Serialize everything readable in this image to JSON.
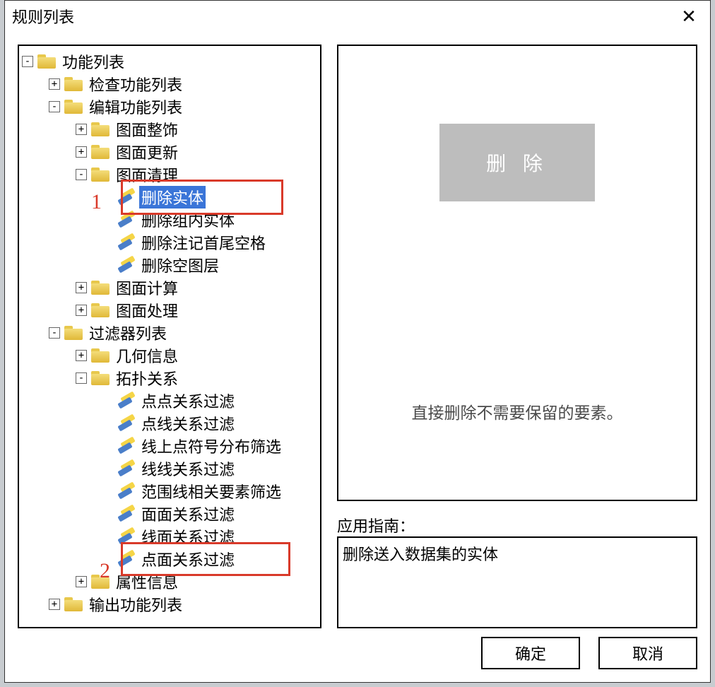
{
  "window": {
    "title": "规则列表"
  },
  "tree": {
    "root": {
      "label": "功能列表",
      "children": {
        "check": {
          "label": "检查功能列表"
        },
        "edit": {
          "label": "编辑功能列表",
          "children": {
            "decorate": {
              "label": "图面整饰"
            },
            "refresh": {
              "label": "图面更新"
            },
            "clean": {
              "label": "图面清理",
              "children": {
                "del_entity": {
                  "label": "删除实体"
                },
                "del_group": {
                  "label": "删除组内实体"
                },
                "del_anno": {
                  "label": "删除注记首尾空格"
                },
                "del_layer": {
                  "label": "删除空图层"
                }
              }
            },
            "calc": {
              "label": "图面计算"
            },
            "process": {
              "label": "图面处理"
            }
          }
        },
        "filter": {
          "label": "过滤器列表",
          "children": {
            "geom": {
              "label": "几何信息"
            },
            "topo": {
              "label": "拓扑关系",
              "children": {
                "pp": {
                  "label": "点点关系过滤"
                },
                "pl": {
                  "label": "点线关系过滤"
                },
                "lsym": {
                  "label": "线上点符号分布筛选"
                },
                "ll": {
                  "label": "线线关系过滤"
                },
                "range": {
                  "label": "范围线相关要素筛选"
                },
                "aa": {
                  "label": "面面关系过滤"
                },
                "la": {
                  "label": "线面关系过滤"
                },
                "pa": {
                  "label": "点面关系过滤"
                }
              }
            },
            "attr": {
              "label": "属性信息"
            }
          }
        },
        "output": {
          "label": "输出功能列表"
        }
      }
    }
  },
  "right": {
    "delete_button": "删 除",
    "preview_text": "直接删除不需要保留的要素。",
    "guide_label": "应用指南：",
    "guide_text": "删除送入数据集的实体"
  },
  "footer": {
    "ok": "确定",
    "cancel": "取消"
  },
  "annotations": {
    "n1": "1",
    "n2": "2"
  }
}
